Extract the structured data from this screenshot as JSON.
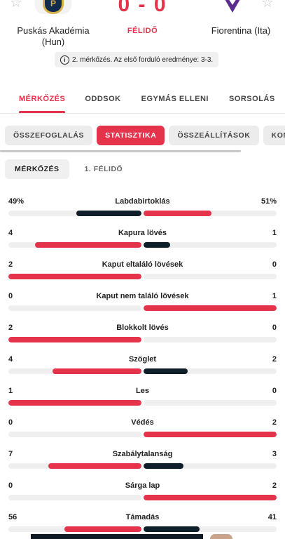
{
  "match": {
    "home_team": "Puskás Akadémia (Hun)",
    "away_team": "Fiorentina (Ita)",
    "score": "0 - 0",
    "status": "FÉLIDŐ",
    "note": "2. mérkőzés. Az első forduló eredménye: 3-3.",
    "home_logo_letter": "P"
  },
  "main_tabs": [
    "MÉRKŐZÉS",
    "ODDSOK",
    "EGYMÁS ELLENI",
    "SORSOLÁS"
  ],
  "sub_tabs": [
    "ÖSSZEFOGLALÁS",
    "STATISZTIKA",
    "ÖSSZEÁLLÍTÁSOK",
    "KOM"
  ],
  "period_tabs": [
    "MÉRKŐZÉS",
    "1. FÉLIDŐ"
  ],
  "colors": {
    "accent": "#e4334a",
    "dark": "#0f1f2a",
    "track": "#efefef"
  },
  "stats": [
    {
      "name": "Labdabirtoklás",
      "home": "49%",
      "away": "51%",
      "home_share": 0.49,
      "away_share": 0.51,
      "winner": "away"
    },
    {
      "name": "Kapura lövés",
      "home": "4",
      "away": "1",
      "home_share": 0.8,
      "away_share": 0.2,
      "winner": "home"
    },
    {
      "name": "Kaput eltaláló lövések",
      "home": "2",
      "away": "0",
      "home_share": 1.0,
      "away_share": 0.0,
      "winner": "home"
    },
    {
      "name": "Kaput nem találó lövések",
      "home": "0",
      "away": "1",
      "home_share": 0.0,
      "away_share": 1.0,
      "winner": "away"
    },
    {
      "name": "Blokkolt lövés",
      "home": "2",
      "away": "0",
      "home_share": 1.0,
      "away_share": 0.0,
      "winner": "home"
    },
    {
      "name": "Szöglet",
      "home": "4",
      "away": "2",
      "home_share": 0.667,
      "away_share": 0.333,
      "winner": "home"
    },
    {
      "name": "Les",
      "home": "1",
      "away": "0",
      "home_share": 1.0,
      "away_share": 0.0,
      "winner": "home"
    },
    {
      "name": "Védés",
      "home": "0",
      "away": "2",
      "home_share": 0.0,
      "away_share": 1.0,
      "winner": "away"
    },
    {
      "name": "Szabálytalanság",
      "home": "7",
      "away": "3",
      "home_share": 0.7,
      "away_share": 0.3,
      "winner": "home"
    },
    {
      "name": "Sárga lap",
      "home": "0",
      "away": "2",
      "home_share": 0.0,
      "away_share": 1.0,
      "winner": "away"
    },
    {
      "name": "Támadás",
      "home": "56",
      "away": "41",
      "home_share": 0.577,
      "away_share": 0.423,
      "winner": "home"
    }
  ]
}
